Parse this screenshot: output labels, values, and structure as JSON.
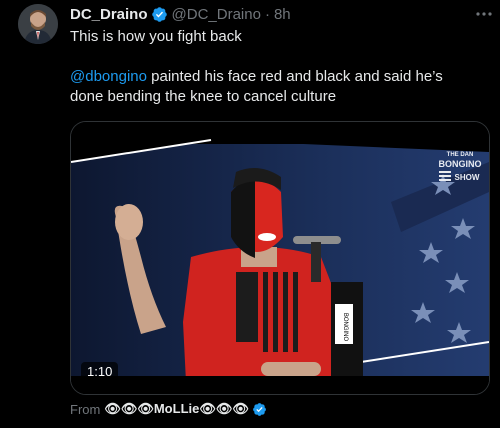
{
  "tweet": {
    "author_name": "DC_Draino",
    "author_handle": "@DC_Draino",
    "separator": "·",
    "time": "8h",
    "text_line1": "This is how you fight back",
    "mention": "@dbongino",
    "text_rest": " painted his face red and black and said he’s done bending the knee to cancel culture",
    "video_duration": "1:10",
    "video_watermark": [
      "THE DAN",
      "BONGINO",
      "SHOW"
    ],
    "from_label": "From",
    "from_name": "👁👁👁MoLLie👁👁👁"
  },
  "colors": {
    "background": "#000000",
    "text": "#e7e9ea",
    "muted": "#71767b",
    "accent": "#1d9bf0"
  },
  "icons": {
    "verified": "verified-badge-icon",
    "more": "more-options-icon"
  }
}
